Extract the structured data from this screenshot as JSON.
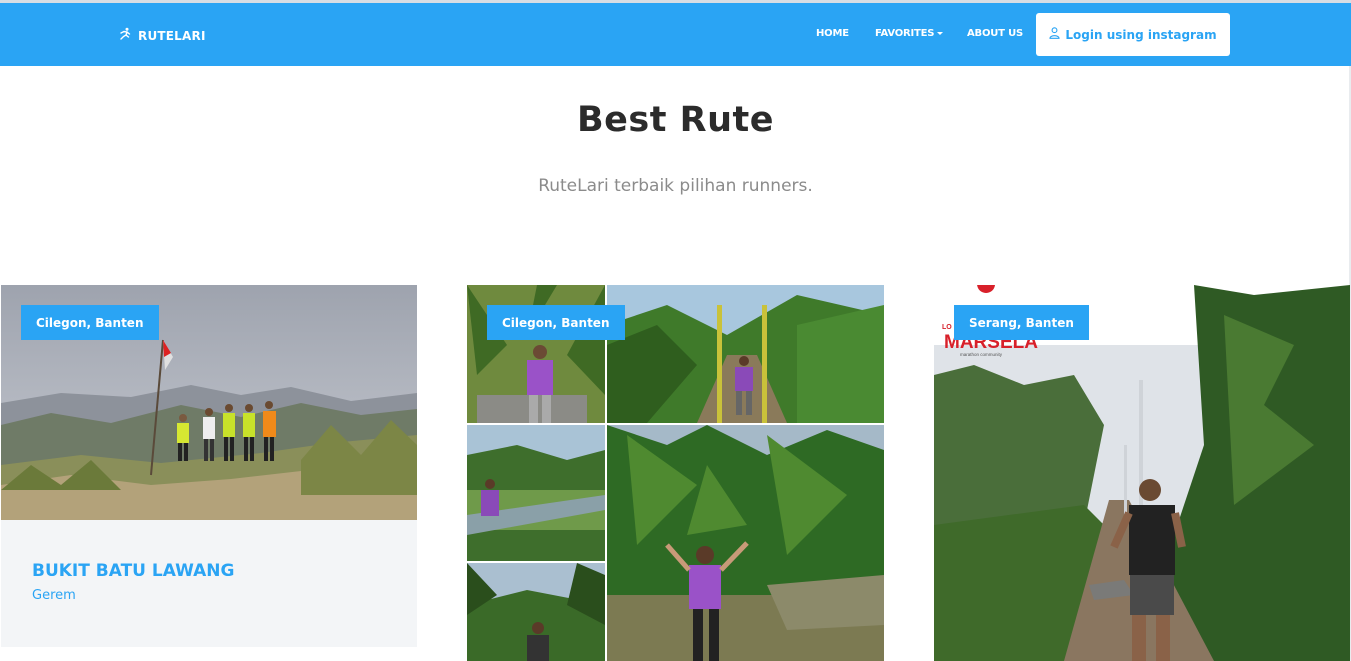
{
  "nav": {
    "brand": "RUTELARI",
    "home": "HOME",
    "favorites": "FAVORITES",
    "about": "ABOUT US",
    "login": "Login using instagram"
  },
  "hero": {
    "title": "Best Rute",
    "subtitle": "RuteLari terbaik pilihan runners."
  },
  "cards": [
    {
      "location": "Cilegon, Banten",
      "title": "BUKIT BATU LAWANG",
      "subtitle": "Gerem"
    },
    {
      "location": "Cilegon, Banten"
    },
    {
      "location": "Serang, Banten",
      "logo_text": "MARSELA",
      "logo_small": "marathon community",
      "logo_prefix": "LO"
    }
  ],
  "colors": {
    "accent": "#2aa4f4",
    "title": "#2b2b2b",
    "muted": "#8b8b8b",
    "card_bg": "#f3f5f7"
  },
  "icons": {
    "brand": "running-icon",
    "login": "user-icon",
    "favorites": "caret-down-icon"
  }
}
